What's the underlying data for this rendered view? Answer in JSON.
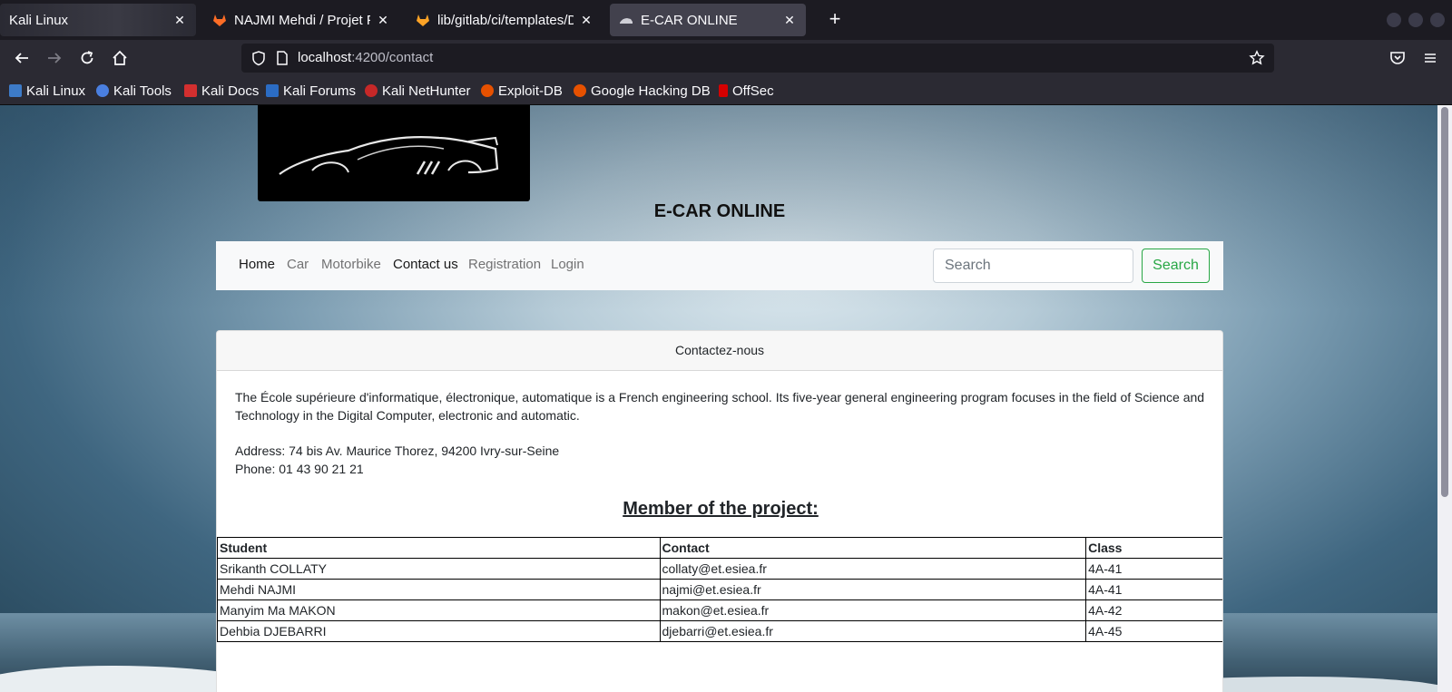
{
  "browser": {
    "tabs": [
      {
        "title": "Kali Linux",
        "active": false
      },
      {
        "title": "NAJMI Mehdi / Projet Full_",
        "active": false
      },
      {
        "title": "lib/gitlab/ci/templates/Do",
        "active": false
      },
      {
        "title": "E-CAR ONLINE",
        "active": true
      }
    ],
    "url_host": "localhost",
    "url_rest": ":4200/contact",
    "bookmarks": [
      "Kali Linux",
      "Kali Tools",
      "Kali Docs",
      "Kali Forums",
      "Kali NetHunter",
      "Exploit-DB",
      "Google Hacking DB",
      "OffSec"
    ]
  },
  "site": {
    "title": "E-CAR ONLINE",
    "nav": [
      "Home",
      "Car",
      "Motorbike",
      "Contact us",
      "Registration",
      "Login"
    ],
    "search_placeholder": "Search",
    "search_button": "Search"
  },
  "contact": {
    "header": "Contactez-nous",
    "description": "The École supérieure d'informatique, électronique, automatique is a French engineering school. Its five-year general engineering program focuses in the field of Science and Technology in the Digital Computer, electronic and automatic.",
    "address": "Address: 74 bis Av. Maurice Thorez, 94200 Ivry-sur-Seine",
    "phone": "Phone: 01 43 90 21 21",
    "members_title": "Member of the project:",
    "table_headers": [
      "Student",
      "Contact",
      "Class"
    ],
    "members": [
      [
        "Srikanth COLLATY",
        "collaty@et.esiea.fr",
        "4A-41"
      ],
      [
        "Mehdi NAJMI",
        "najmi@et.esiea.fr",
        "4A-41"
      ],
      [
        "Manyim Ma MAKON",
        "makon@et.esiea.fr",
        "4A-42"
      ],
      [
        "Dehbia DJEBARRI",
        "djebarri@et.esiea.fr",
        "4A-45"
      ]
    ]
  },
  "colors": {
    "browser_dark": "#1c1b22",
    "toolbar": "#2b2a33",
    "success": "#28a745"
  }
}
